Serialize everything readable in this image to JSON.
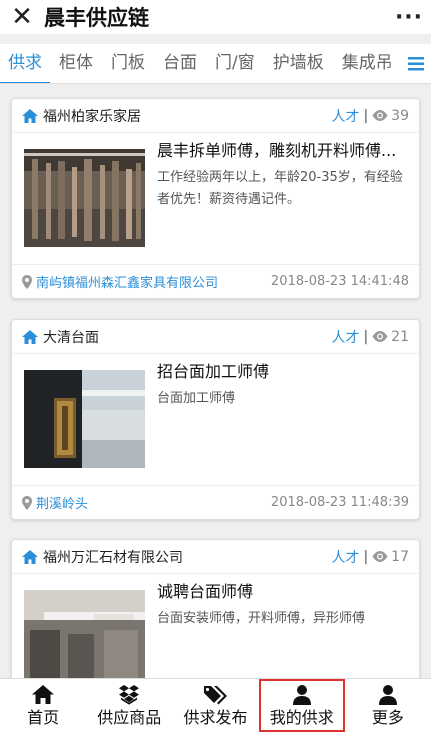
{
  "header": {
    "title": "晨丰供应链"
  },
  "tabs": [
    {
      "label": "供求",
      "active": true
    },
    {
      "label": "柜体"
    },
    {
      "label": "门板"
    },
    {
      "label": "台面"
    },
    {
      "label": "门/窗"
    },
    {
      "label": "护墙板"
    },
    {
      "label": "集成吊"
    }
  ],
  "cards": [
    {
      "company": "福州柏家乐家居",
      "category": "人才",
      "separator": "|",
      "views": "39",
      "job_title": "晨丰拆单师傅，雕刻机开料师傅...",
      "job_desc": "工作经验两年以上，年龄20-35岁，有经验者优先！薪资待遇记件。",
      "location": "南屿镇福州森汇鑫家具有限公司",
      "time": "2018-08-23 14:41:48"
    },
    {
      "company": "大清台面",
      "category": "人才",
      "separator": "|",
      "views": "21",
      "job_title": "招台面加工师傅",
      "job_desc": "台面加工师傅",
      "location": "荆溪岭头",
      "time": "2018-08-23 11:48:39"
    },
    {
      "company": "福州万汇石材有限公司",
      "category": "人才",
      "separator": "|",
      "views": "17",
      "job_title": "诚聘台面师傅",
      "job_desc": "台面安装师傅，开料师傅，异形师傅",
      "location": "",
      "time": ""
    }
  ],
  "bottom_nav": [
    {
      "label": "首页",
      "icon": "home-icon"
    },
    {
      "label": "供应商品",
      "icon": "dropbox-icon"
    },
    {
      "label": "供求发布",
      "icon": "tags-icon"
    },
    {
      "label": "我的供求",
      "icon": "user-icon",
      "highlighted": true
    },
    {
      "label": "更多",
      "icon": "user-icon"
    }
  ],
  "colors": {
    "accent": "#2a8fd8",
    "highlight_border": "#e0322f"
  }
}
